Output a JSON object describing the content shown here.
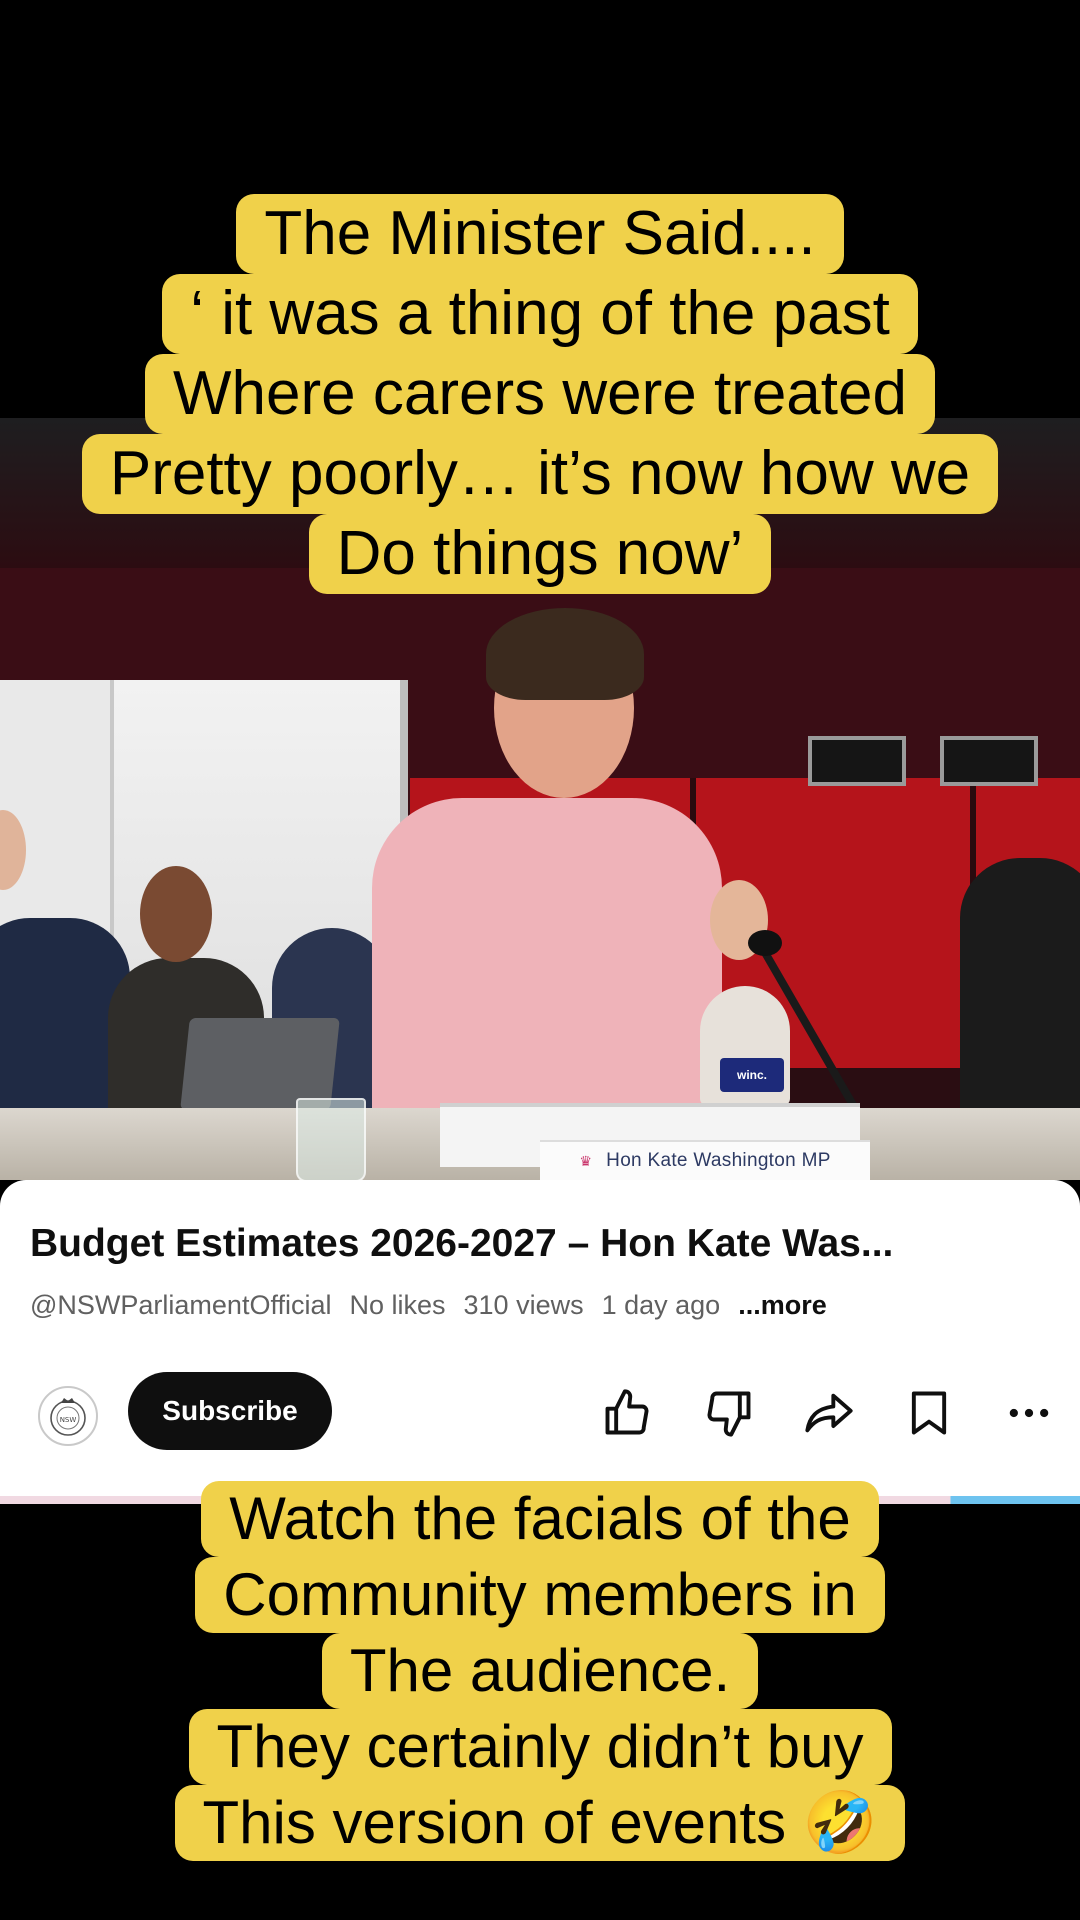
{
  "captions": {
    "top": [
      "The Minister Said....",
      "‘ it was a thing of the past",
      "Where carers were treated",
      "Pretty poorly… it’s now how we",
      "Do things now’"
    ],
    "bottom": [
      "Watch the facials of the",
      "Community members in",
      "The audience.",
      "They certainly didn’t buy",
      "This version of events 🤣"
    ]
  },
  "video": {
    "nameplate": "Hon Kate Washington MP",
    "box_label": "winc."
  },
  "youtube": {
    "title": "Budget Estimates 2026-2027 – Hon Kate Was...",
    "channel": "@NSWParliamentOfficial",
    "likes": "No likes",
    "views": "310 views",
    "age": "1 day ago",
    "more_label": "...more",
    "subscribe_label": "Subscribe",
    "avatar_icon": "nsw-parliament-crest-icon",
    "action_icons": [
      "like-icon",
      "dislike-icon",
      "share-icon",
      "save-icon",
      "more-icon"
    ]
  }
}
